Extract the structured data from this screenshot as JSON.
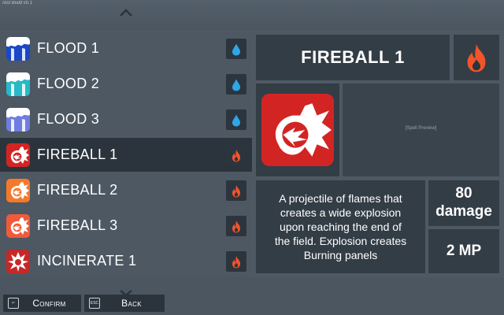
{
  "build_label": "Test Build v0.1",
  "spells": [
    {
      "name": "FLOOD 1",
      "element": "water",
      "icon": "flood-icon",
      "icon_colors": [
        "#1a47c8",
        "#ffffff"
      ],
      "selected": false
    },
    {
      "name": "FLOOD 2",
      "element": "water",
      "icon": "flood-icon",
      "icon_colors": [
        "#27b9c5",
        "#ffffff"
      ],
      "selected": false
    },
    {
      "name": "FLOOD 3",
      "element": "water",
      "icon": "flood-icon",
      "icon_colors": [
        "#6f7de0",
        "#ffffff"
      ],
      "selected": false
    },
    {
      "name": "FIREBALL 1",
      "element": "fire",
      "icon": "fireball-icon",
      "icon_colors": [
        "#d32424",
        "#ffffff"
      ],
      "selected": true
    },
    {
      "name": "FIREBALL 2",
      "element": "fire",
      "icon": "fireball-icon",
      "icon_colors": [
        "#f5792a",
        "#ffffff"
      ],
      "selected": false
    },
    {
      "name": "FIREBALL 3",
      "element": "fire",
      "icon": "fireball-icon",
      "icon_colors": [
        "#f05a3a",
        "#ffffff"
      ],
      "selected": false
    },
    {
      "name": "INCINERATE 1",
      "element": "fire",
      "icon": "incinerate-icon",
      "icon_colors": [
        "#c62828",
        "#ffffff"
      ],
      "selected": false
    }
  ],
  "element_colors": {
    "water": "#2fa6e8",
    "fire": "#f2542a"
  },
  "detail": {
    "title": "FIREBALL 1",
    "element": "fire",
    "icon": "fireball-icon",
    "preview_placeholder": "[Spell Preview]",
    "description_lines": [
      "A projectile of flames that",
      "creates a wide explosion",
      "upon reaching the end of",
      "the field. Explosion creates",
      "Burning panels"
    ],
    "damage_value": "80",
    "damage_unit": "damage",
    "mp_cost": "2 MP"
  },
  "buttons": {
    "confirm": {
      "key": "↵",
      "label": "Confirm"
    },
    "back": {
      "key": "ESC",
      "label": "Back"
    }
  }
}
